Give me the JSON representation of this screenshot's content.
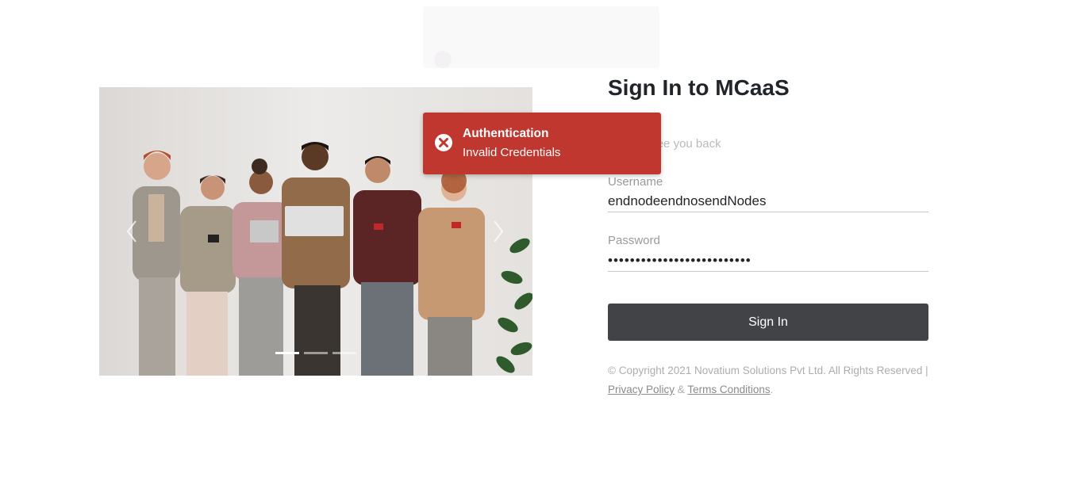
{
  "signin": {
    "title": "Sign In to MCaaS",
    "subtitle": "good to see you back",
    "username_label": "Username",
    "username_value": "endnodeendnosendNodes",
    "password_label": "Password",
    "password_value": "••••••••••••••••••••••••••",
    "button_label": "Sign In"
  },
  "footer": {
    "copyright": "© Copyright 2021 Novatium Solutions Pvt Ltd. All Rights Reserved |",
    "privacy_link": "Privacy Policy",
    "separator": "&",
    "terms_link": "Terms Conditions",
    "end": "."
  },
  "toast": {
    "title": "Authentication",
    "message": "Invalid Credentials",
    "color": "#c0372f",
    "icon": "close-circle-icon"
  },
  "carousel": {
    "active_index": 0,
    "slide_count": 3,
    "prev_icon": "chevron-left-icon",
    "next_icon": "chevron-right-icon"
  },
  "colors": {
    "button_bg": "#424347",
    "title": "#212529",
    "muted": "#adadad"
  }
}
